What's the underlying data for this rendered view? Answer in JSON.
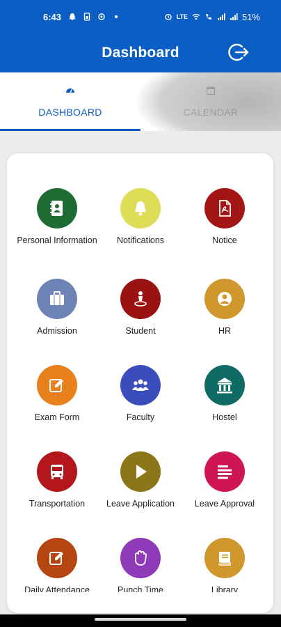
{
  "status_bar": {
    "time": "6:43",
    "battery": "51%",
    "network": "LTE"
  },
  "app_bar": {
    "title": "Dashboard",
    "logout_icon": "logout-icon"
  },
  "tabs": [
    {
      "label": "DASHBOARD",
      "icon": "speedometer-icon",
      "active": true
    },
    {
      "label": "CALENDAR",
      "icon": "calendar-icon",
      "active": false
    }
  ],
  "colors": {
    "primary": "#0b5ec4",
    "tab_inactive": "#b5b5b5"
  },
  "menu": [
    {
      "label": "Personal Information",
      "icon": "contact-book-icon",
      "color": "#1e6b34"
    },
    {
      "label": "Notifications",
      "icon": "bell-icon",
      "color": "#dedd58"
    },
    {
      "label": "Notice",
      "icon": "pdf-file-icon",
      "color": "#a41515"
    },
    {
      "label": "Admission",
      "icon": "briefcase-icon",
      "color": "#6f84b6"
    },
    {
      "label": "Student",
      "icon": "person-pin-icon",
      "color": "#9a1212"
    },
    {
      "label": "HR",
      "icon": "user-circle-icon",
      "color": "#cf972c"
    },
    {
      "label": "Exam Form",
      "icon": "edit-icon",
      "color": "#e8811b"
    },
    {
      "label": "Faculty",
      "icon": "group-icon",
      "color": "#3a4dbd"
    },
    {
      "label": "Hostel",
      "icon": "building-icon",
      "color": "#0f6b63"
    },
    {
      "label": "Transportation",
      "icon": "bus-icon",
      "color": "#b3161b"
    },
    {
      "label": "Leave Application",
      "icon": "play-icon",
      "color": "#8b761a"
    },
    {
      "label": "Leave Approval",
      "icon": "list-icon",
      "color": "#cf1553"
    },
    {
      "label": "Daily Attendance",
      "icon": "edit-icon",
      "color": "#b54612"
    },
    {
      "label": "Punch Time",
      "icon": "hand-icon",
      "color": "#8f3ab8"
    },
    {
      "label": "Library",
      "icon": "book-icon",
      "color": "#cf972c"
    }
  ]
}
